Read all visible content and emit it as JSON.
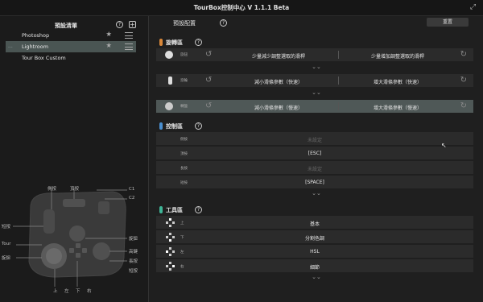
{
  "window": {
    "title": "TourBox控制中心 V 1.1.1 Beta"
  },
  "left_panel": {
    "header": "預設清單",
    "presets": [
      {
        "name": "Photoshop",
        "active": false,
        "dots": ""
      },
      {
        "name": "Lightroom",
        "active": true,
        "dots": "..."
      },
      {
        "name": "Tour Box Custom",
        "active": false,
        "dots": ""
      }
    ],
    "device_labels": [
      "側按",
      "頂按",
      "C1",
      "C2",
      "短按",
      "旋鈕",
      "Tour",
      "高鍵",
      "上",
      "左",
      "下",
      "右",
      "旋鈕",
      "長按",
      "短按"
    ]
  },
  "right_panel": {
    "tab": "預設配置",
    "reset_label": "重置",
    "sections": [
      {
        "title": "旋轉區",
        "color": "#d9883a"
      },
      {
        "title": "控制區",
        "color": "#4a8fd0"
      },
      {
        "title": "工具區",
        "color": "#3fb597"
      }
    ],
    "knob_rows": [
      {
        "label": "旋鈕",
        "left": "少量減少調整選取的滑桿",
        "right": "少量增加調整選取的滑桿",
        "highlight": false
      },
      {
        "label": "滾輪",
        "left": "減小滑條參數（快速）",
        "right": "增大滑條參數（快速）",
        "highlight": false
      },
      {
        "label": "轉盤",
        "left": "減小滑條參數（慢速）",
        "right": "增大滑條參數（慢速）",
        "highlight": true
      }
    ],
    "control_rows": [
      {
        "label": "側按",
        "value": "未設定",
        "muted": true
      },
      {
        "label": "頂按",
        "value": "[ESC]",
        "muted": false
      },
      {
        "label": "長按",
        "value": "未設定",
        "muted": true
      },
      {
        "label": "短按",
        "value": "[SPACE]",
        "muted": false
      }
    ],
    "tool_rows": [
      {
        "label": "上",
        "value": "基本"
      },
      {
        "label": "下",
        "value": "分割色調"
      },
      {
        "label": "左",
        "value": "HSL"
      },
      {
        "label": "右",
        "value": "細節"
      }
    ]
  }
}
